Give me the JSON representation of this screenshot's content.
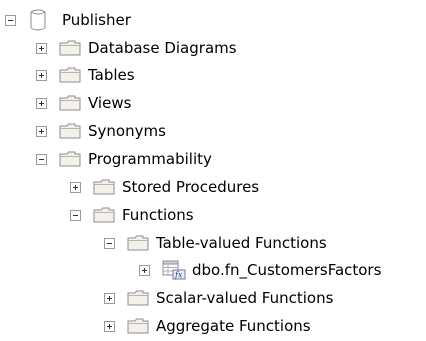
{
  "tree": {
    "root": {
      "label": "Publisher",
      "icon": "database-icon",
      "state": "expanded"
    },
    "children": [
      {
        "label": "Database Diagrams",
        "icon": "folder-icon",
        "state": "collapsed"
      },
      {
        "label": "Tables",
        "icon": "folder-icon",
        "state": "collapsed"
      },
      {
        "label": "Views",
        "icon": "folder-icon",
        "state": "collapsed"
      },
      {
        "label": "Synonyms",
        "icon": "folder-icon",
        "state": "collapsed"
      },
      {
        "label": "Programmability",
        "icon": "folder-icon",
        "state": "expanded",
        "children": [
          {
            "label": "Stored Procedures",
            "icon": "folder-icon",
            "state": "collapsed"
          },
          {
            "label": "Functions",
            "icon": "folder-icon",
            "state": "expanded",
            "children": [
              {
                "label": "Table-valued Functions",
                "icon": "folder-icon",
                "state": "expanded",
                "children": [
                  {
                    "label": "dbo.fn_CustomersFactors",
                    "icon": "table-function-icon",
                    "state": "collapsed"
                  }
                ]
              },
              {
                "label": "Scalar-valued Functions",
                "icon": "folder-icon",
                "state": "collapsed"
              },
              {
                "label": "Aggregate Functions",
                "icon": "folder-icon",
                "state": "collapsed"
              }
            ]
          }
        ]
      }
    ]
  },
  "colors": {
    "folder_fill": "#f3f1ea",
    "folder_stroke": "#8e8e8e",
    "toggle_border": "#9a9a9a",
    "text": "#000000"
  }
}
